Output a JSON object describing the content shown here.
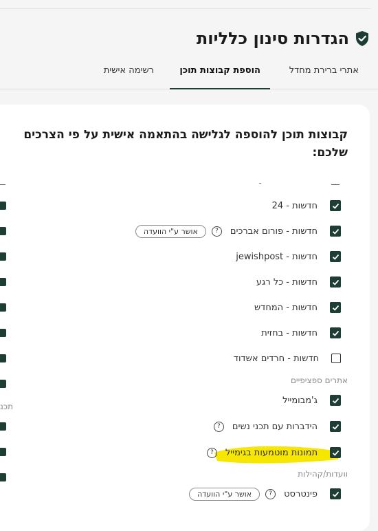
{
  "header": {
    "title": "הגדרות סינון כלליות",
    "icon": "shield-check-icon",
    "accent": "#1d3c34"
  },
  "tabs": [
    {
      "label": "אתרי ברירת מחדל",
      "active": false
    },
    {
      "label": "הוספת קבוצות תוכן",
      "active": true
    },
    {
      "label": "רשימה אישית",
      "active": false
    }
  ],
  "content": {
    "heading": "קבוצות תוכן להוספה לגלישה בהתאמה אישית על פי הצרכים שלכם:",
    "news_items": [
      {
        "label": "חדשות - 24",
        "checked": true
      },
      {
        "label": "חדשות - פורום אברכים",
        "checked": true,
        "help": "?",
        "badge": "אושר ע\"י הוועדה"
      },
      {
        "label": "חדשות - jewishpost",
        "checked": true
      },
      {
        "label": "חדשות - כל רגע",
        "checked": true
      },
      {
        "label": "חדשות - המחדש",
        "checked": true
      },
      {
        "label": "חדשות - בחזית",
        "checked": true
      },
      {
        "label": "חדשות - חרדים אשדוד",
        "checked": false
      }
    ],
    "specific_sites_label": "אתרים ספציפיים",
    "specific_items": [
      {
        "label": "ג'מבומייל",
        "checked": true
      },
      {
        "label": "הידברות עם תכני נשים",
        "checked": true,
        "help": "?"
      },
      {
        "label": "תמונות מוטמעות בגימייל",
        "checked": true,
        "help": "?",
        "highlight_color": "#f7e600"
      }
    ],
    "committees_label": "וועדות/קהילות",
    "committee_items": [
      {
        "label": "פינטרסט",
        "checked": true,
        "help": "?",
        "badge": "אושר ע\"י הוועדה"
      }
    ],
    "left_column_fragment": "תכנ"
  }
}
